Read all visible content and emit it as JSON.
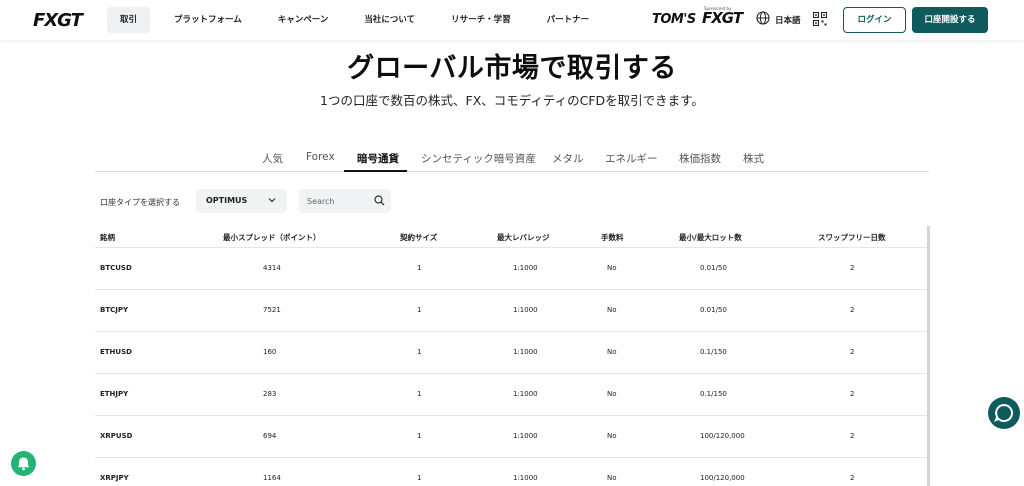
{
  "header": {
    "logo": "FXGT",
    "nav": [
      "取引",
      "プラットフォーム",
      "キャンペーン",
      "当社について",
      "リサーチ・学習",
      "パートナー"
    ],
    "partner_logo": "TOM'S",
    "partner_brand": "FXGT",
    "partner_sub": "Sponsored by",
    "language": "日本語",
    "login_label": "ログイン",
    "open_account_label": "口座開設する"
  },
  "hero": {
    "title": "グローバル市場で取引する",
    "subtitle": "1つの口座で数百の株式、FX、コモディティのCFDを取引できます。"
  },
  "tabs": [
    "人気",
    "Forex",
    "暗号通貨",
    "シンセティック暗号資産",
    "メタル",
    "エネルギー",
    "株価指数",
    "株式"
  ],
  "active_tab": "暗号通貨",
  "filters": {
    "account_type_label": "口座タイプを選択する",
    "account_type_value": "OPTIMUS",
    "search_placeholder": "Search"
  },
  "table": {
    "headers": [
      "銘柄",
      "最小スプレッド（ポイント）",
      "契約サイズ",
      "最大レバレッジ",
      "手数料",
      "最小/最大ロット数",
      "スワップフリー日数"
    ],
    "rows": [
      [
        "BTCUSD",
        "4314",
        "1",
        "1:1000",
        "No",
        "0.01/50",
        "2"
      ],
      [
        "BTCJPY",
        "7521",
        "1",
        "1:1000",
        "No",
        "0.01/50",
        "2"
      ],
      [
        "ETHUSD",
        "160",
        "1",
        "1:1000",
        "No",
        "0.1/150",
        "2"
      ],
      [
        "ETHJPY",
        "283",
        "1",
        "1:1000",
        "No",
        "0.1/150",
        "2"
      ],
      [
        "XRPUSD",
        "694",
        "1",
        "1:1000",
        "No",
        "100/120,000",
        "2"
      ],
      [
        "XRPJPY",
        "1164",
        "1",
        "1:1000",
        "No",
        "100/120,000",
        "2"
      ]
    ]
  },
  "colors": {
    "brand_teal": "#0e5a5c",
    "bell_green": "#22b573"
  }
}
